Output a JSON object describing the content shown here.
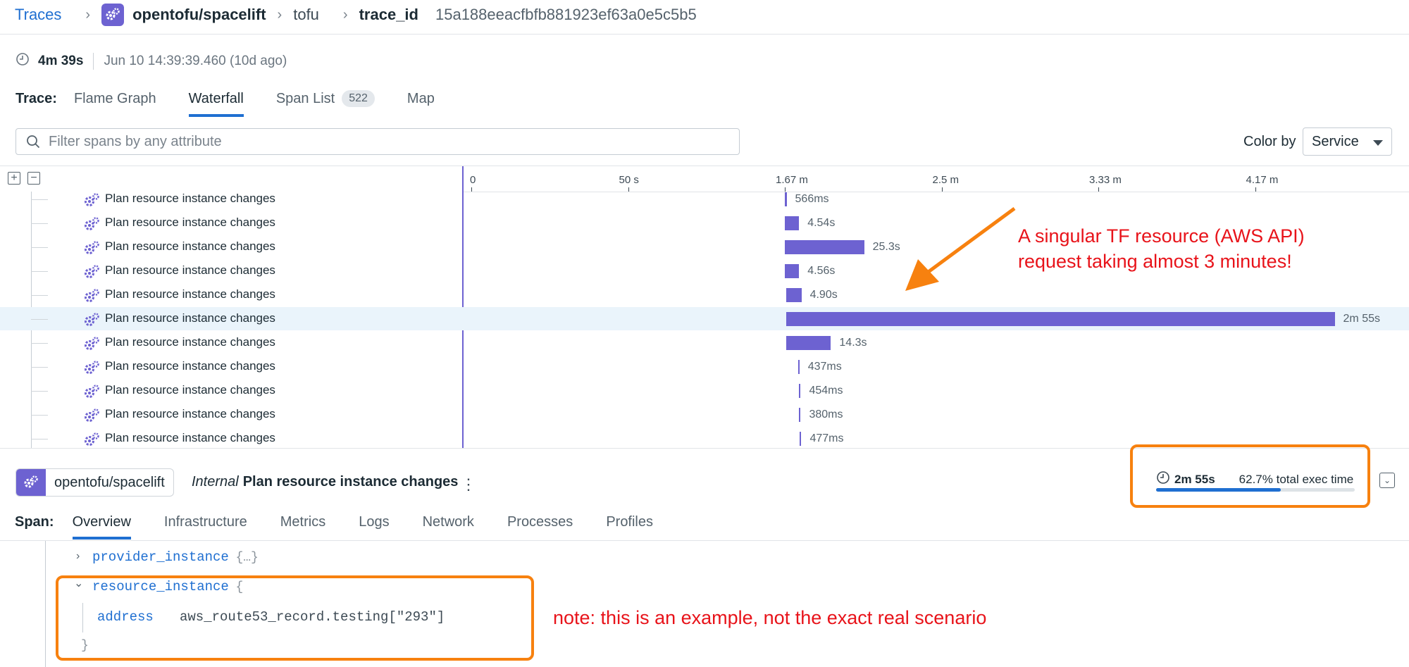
{
  "breadcrumb": {
    "root": "Traces",
    "service": "opentofu/spacelift",
    "operation": "tofu",
    "id_label": "trace_id",
    "id_value": "15a188eeacfbfb881923ef63a0e5c5b5"
  },
  "summary": {
    "duration": "4m 39s",
    "started": "Jun 10 14:39:39.460 (10d ago)"
  },
  "trace_tabs": {
    "label": "Trace:",
    "tabs": [
      {
        "label": "Flame Graph",
        "active": false
      },
      {
        "label": "Waterfall",
        "active": true
      },
      {
        "label": "Span List",
        "count": "522",
        "active": false
      },
      {
        "label": "Map",
        "active": false
      }
    ]
  },
  "filter": {
    "placeholder": "Filter spans by any attribute",
    "value": ""
  },
  "color_by": {
    "label": "Color by",
    "selected": "Service"
  },
  "axis": {
    "ticks": [
      "0",
      "50 s",
      "1.67 m",
      "2.5 m",
      "3.33 m",
      "4.17 m"
    ]
  },
  "spans": [
    {
      "name": "Plan resource instance changes",
      "start_s": 100.0,
      "duration_s": 0.566,
      "label": "566ms"
    },
    {
      "name": "Plan resource instance changes",
      "start_s": 100.0,
      "duration_s": 4.54,
      "label": "4.54s"
    },
    {
      "name": "Plan resource instance changes",
      "start_s": 100.0,
      "duration_s": 25.3,
      "label": "25.3s"
    },
    {
      "name": "Plan resource instance changes",
      "start_s": 100.0,
      "duration_s": 4.56,
      "label": "4.56s"
    },
    {
      "name": "Plan resource instance changes",
      "start_s": 100.4,
      "duration_s": 4.9,
      "label": "4.90s"
    },
    {
      "name": "Plan resource instance changes",
      "start_s": 100.4,
      "duration_s": 175,
      "label": "2m 55s",
      "selected": true
    },
    {
      "name": "Plan resource instance changes",
      "start_s": 100.4,
      "duration_s": 14.3,
      "label": "14.3s"
    },
    {
      "name": "Plan resource instance changes",
      "start_s": 104.2,
      "duration_s": 0.437,
      "label": "437ms"
    },
    {
      "name": "Plan resource instance changes",
      "start_s": 104.6,
      "duration_s": 0.454,
      "label": "454ms"
    },
    {
      "name": "Plan resource instance changes",
      "start_s": 104.6,
      "duration_s": 0.38,
      "label": "380ms"
    },
    {
      "name": "Plan resource instance changes",
      "start_s": 104.8,
      "duration_s": 0.477,
      "label": "477ms"
    }
  ],
  "annotations": {
    "callout_line1": "A singular TF resource (AWS API)",
    "callout_line2": "request taking almost 3 minutes!",
    "note": "note: this is an example, not the exact real scenario"
  },
  "span_detail": {
    "service": "opentofu/spacelift",
    "kind": "Internal",
    "name": "Plan resource instance changes",
    "duration": "2m 55s",
    "exec_pct_text": "62.7% total exec time",
    "exec_pct": 62.7
  },
  "span_tabs": {
    "label": "Span:",
    "tabs": [
      "Overview",
      "Infrastructure",
      "Metrics",
      "Logs",
      "Network",
      "Processes",
      "Profiles"
    ],
    "active": "Overview"
  },
  "attributes": {
    "provider_key": "provider_instance",
    "provider_collapsed": "{…}",
    "resource_key": "resource_instance",
    "resource_open": "{",
    "address_key": "address",
    "address_value": "aws_route53_record.testing[\"293\"]",
    "resource_close": "}"
  },
  "colors": {
    "accent": "#1f6fd1",
    "span": "#6d62d1",
    "highlight": "#f7810f",
    "annotation": "#e8131a"
  }
}
